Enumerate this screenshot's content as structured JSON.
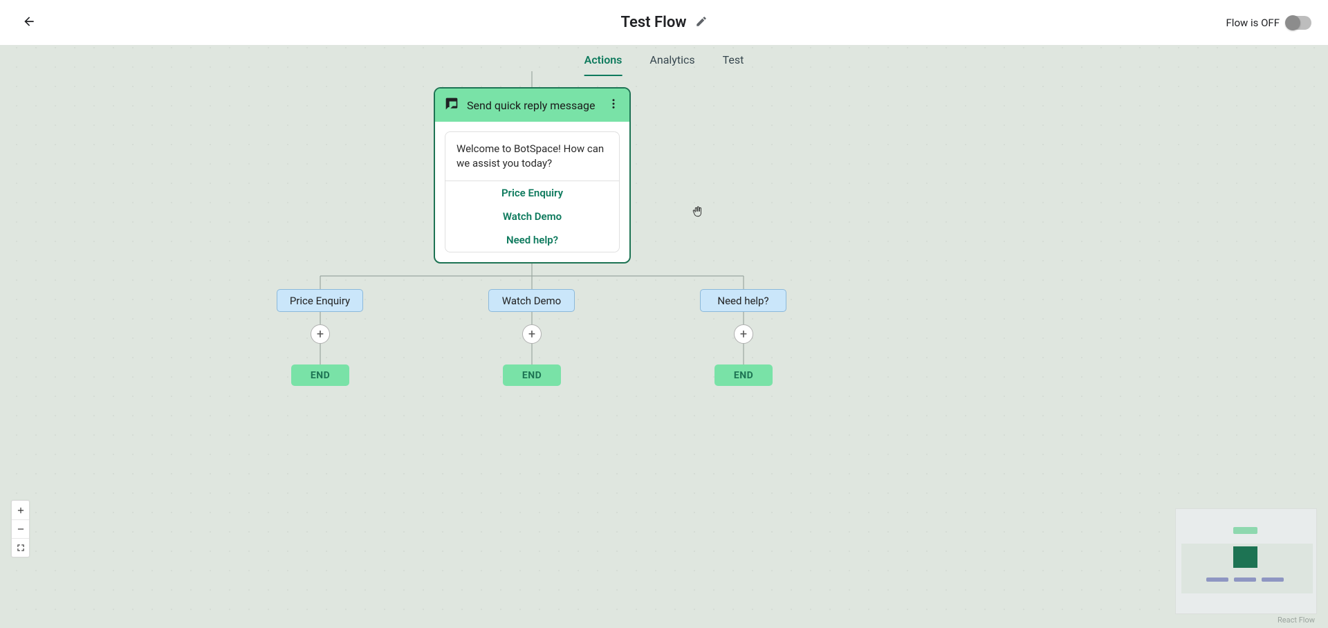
{
  "header": {
    "title": "Test Flow",
    "flow_status_label": "Flow is OFF"
  },
  "tabs": [
    {
      "label": "Actions",
      "active": true
    },
    {
      "label": "Analytics",
      "active": false
    },
    {
      "label": "Test",
      "active": false
    }
  ],
  "main_node": {
    "title": "Send quick reply message",
    "message": "Welcome to BotSpace! How can we assist you today?",
    "options": [
      "Price Enquiry",
      "Watch Demo",
      "Need help?"
    ]
  },
  "branches": [
    {
      "label": "Price Enquiry",
      "end_label": "END"
    },
    {
      "label": "Watch Demo",
      "end_label": "END"
    },
    {
      "label": "Need help?",
      "end_label": "END"
    }
  ],
  "footer": {
    "attribution": "React Flow"
  }
}
